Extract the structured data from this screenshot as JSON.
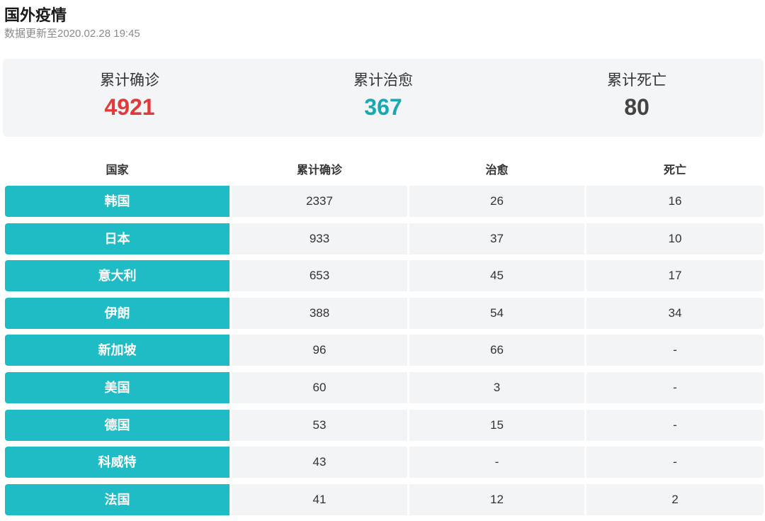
{
  "header": {
    "title": "国外疫情",
    "updated": "数据更新至2020.02.28 19:45"
  },
  "summary": [
    {
      "label": "累计确诊",
      "value": "4921",
      "color": "#e03a3a"
    },
    {
      "label": "累计治愈",
      "value": "367",
      "color": "#1aa8b0"
    },
    {
      "label": "累计死亡",
      "value": "80",
      "color": "#444444"
    }
  ],
  "colors": {
    "accent": "#1fbcc6",
    "cell_bg": "#f3f4f6"
  },
  "table": {
    "columns": [
      "国家",
      "累计确诊",
      "治愈",
      "死亡"
    ],
    "rows": [
      [
        "韩国",
        "2337",
        "26",
        "16"
      ],
      [
        "日本",
        "933",
        "37",
        "10"
      ],
      [
        "意大利",
        "653",
        "45",
        "17"
      ],
      [
        "伊朗",
        "388",
        "54",
        "34"
      ],
      [
        "新加坡",
        "96",
        "66",
        "-"
      ],
      [
        "美国",
        "60",
        "3",
        "-"
      ],
      [
        "德国",
        "53",
        "15",
        "-"
      ],
      [
        "科威特",
        "43",
        "-",
        "-"
      ],
      [
        "法国",
        "41",
        "12",
        "2"
      ]
    ]
  }
}
